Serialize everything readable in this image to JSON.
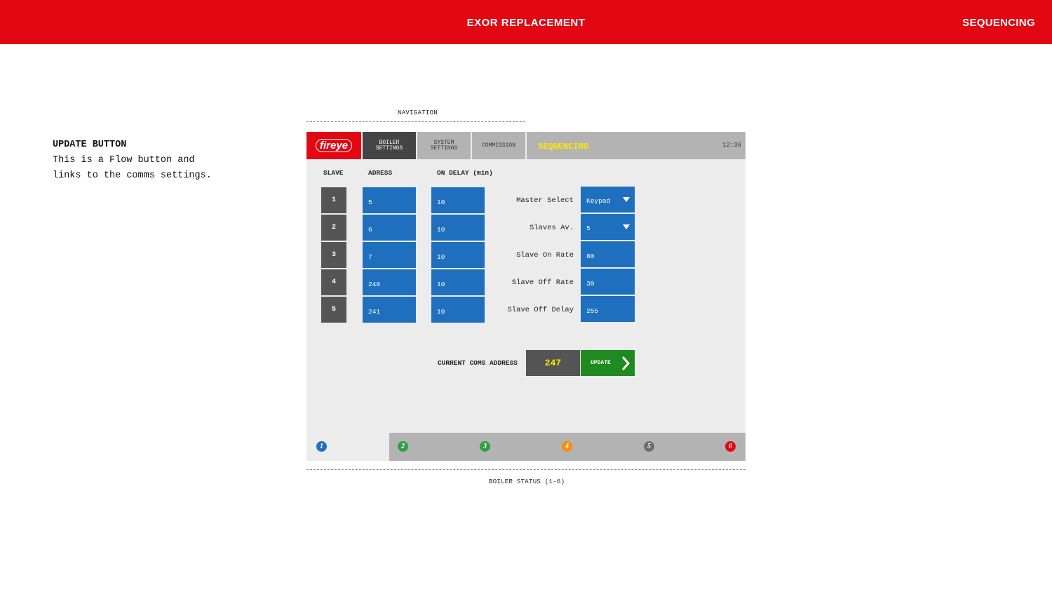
{
  "header": {
    "title": "EXOR REPLACEMENT",
    "section": "SEQUENCING"
  },
  "note": {
    "title": "UPDATE BUTTON",
    "lines": [
      "This is a Flow button and",
      "links to the comms settings."
    ]
  },
  "captions": {
    "navigation": "NAVIGATION",
    "boiler_status": "BOILER STATUS (1-6)"
  },
  "nav": {
    "logo": "fireye",
    "tabs": [
      {
        "line1": "BOILER",
        "line2": "SETTINGS"
      },
      {
        "line1": "SYSTEM",
        "line2": "SETTINGS"
      },
      {
        "line1": "COMMISSION",
        "line2": ""
      }
    ],
    "current": "SEQUENCING",
    "clock": "12:36"
  },
  "table": {
    "headers": {
      "slave": "SLAVE",
      "address": "ADRESS",
      "delay": "ON DELAY (min)"
    },
    "rows": [
      {
        "slave": "1",
        "address": "5",
        "delay": "10"
      },
      {
        "slave": "2",
        "address": "6",
        "delay": "10"
      },
      {
        "slave": "3",
        "address": "7",
        "delay": "10"
      },
      {
        "slave": "4",
        "address": "240",
        "delay": "10"
      },
      {
        "slave": "5",
        "address": "241",
        "delay": "10"
      }
    ]
  },
  "params": [
    {
      "label": "Master Select",
      "value": "Keypad",
      "type": "dropdown"
    },
    {
      "label": "Slaves Av.",
      "value": "5",
      "type": "dropdown"
    },
    {
      "label": "Slave On Rate",
      "value": "80",
      "type": "input"
    },
    {
      "label": "Slave Off Rate",
      "value": "30",
      "type": "input"
    },
    {
      "label": "Slave Off Delay",
      "value": "255",
      "type": "input"
    }
  ],
  "coms": {
    "label": "CURRENT COMS ADDRESS",
    "value": "247",
    "button": "UPDATE"
  },
  "status": {
    "dots": [
      {
        "n": "1",
        "color": "#1f6fbf"
      },
      {
        "n": "2",
        "color": "#2ea043"
      },
      {
        "n": "3",
        "color": "#2ea043"
      },
      {
        "n": "4",
        "color": "#f5900a"
      },
      {
        "n": "5",
        "color": "#6e6e6e"
      },
      {
        "n": "6",
        "color": "#e30613"
      }
    ]
  },
  "colors": {
    "brand_red": "#e30613",
    "field_blue": "#1f6fbf",
    "go_green": "#1f8a1f",
    "accent_yellow": "#ffe600"
  }
}
